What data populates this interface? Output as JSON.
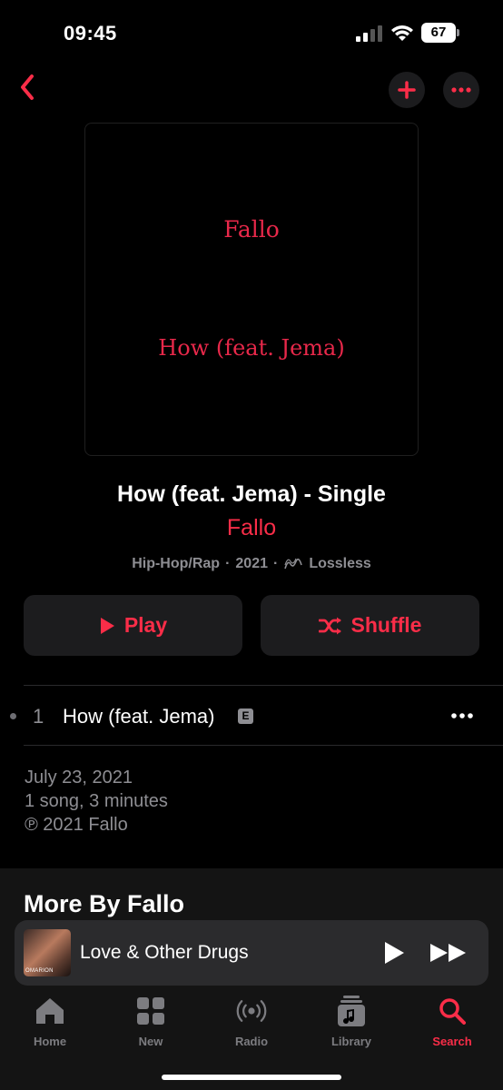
{
  "status_bar": {
    "time": "09:45",
    "battery": "67"
  },
  "nav": {
    "back_icon": "chevron-left-icon",
    "add_icon": "plus-icon",
    "more_icon": "ellipsis-icon"
  },
  "artwork": {
    "artist_text": "Fallo",
    "title_text": "How (feat. Jema)"
  },
  "album": {
    "title": "How (feat. Jema) - Single",
    "artist": "Fallo",
    "genre": "Hip-Hop/Rap",
    "separator": "·",
    "year": "2021",
    "quality": "Lossless"
  },
  "actions": {
    "play_label": "Play",
    "shuffle_label": "Shuffle"
  },
  "tracks": [
    {
      "number": "1",
      "title": "How (feat. Jema)",
      "explicit": "E"
    }
  ],
  "release_info": {
    "date": "July 23, 2021",
    "summary": "1 song, 3 minutes",
    "copyright": "℗ 2021 Fallo"
  },
  "more_by": {
    "title": "More By Fallo"
  },
  "mini_player": {
    "title": "Love & Other Drugs",
    "art_label": "OMARION"
  },
  "tabs": [
    {
      "label": "Home",
      "icon": "home-icon",
      "active": false
    },
    {
      "label": "New",
      "icon": "grid-icon",
      "active": false
    },
    {
      "label": "Radio",
      "icon": "radio-icon",
      "active": false
    },
    {
      "label": "Library",
      "icon": "library-icon",
      "active": false
    },
    {
      "label": "Search",
      "icon": "search-icon",
      "active": true
    }
  ],
  "colors": {
    "accent": "#fa2d48",
    "background": "#000000",
    "secondary_text": "#8e8e93",
    "card": "#1c1c1e"
  }
}
